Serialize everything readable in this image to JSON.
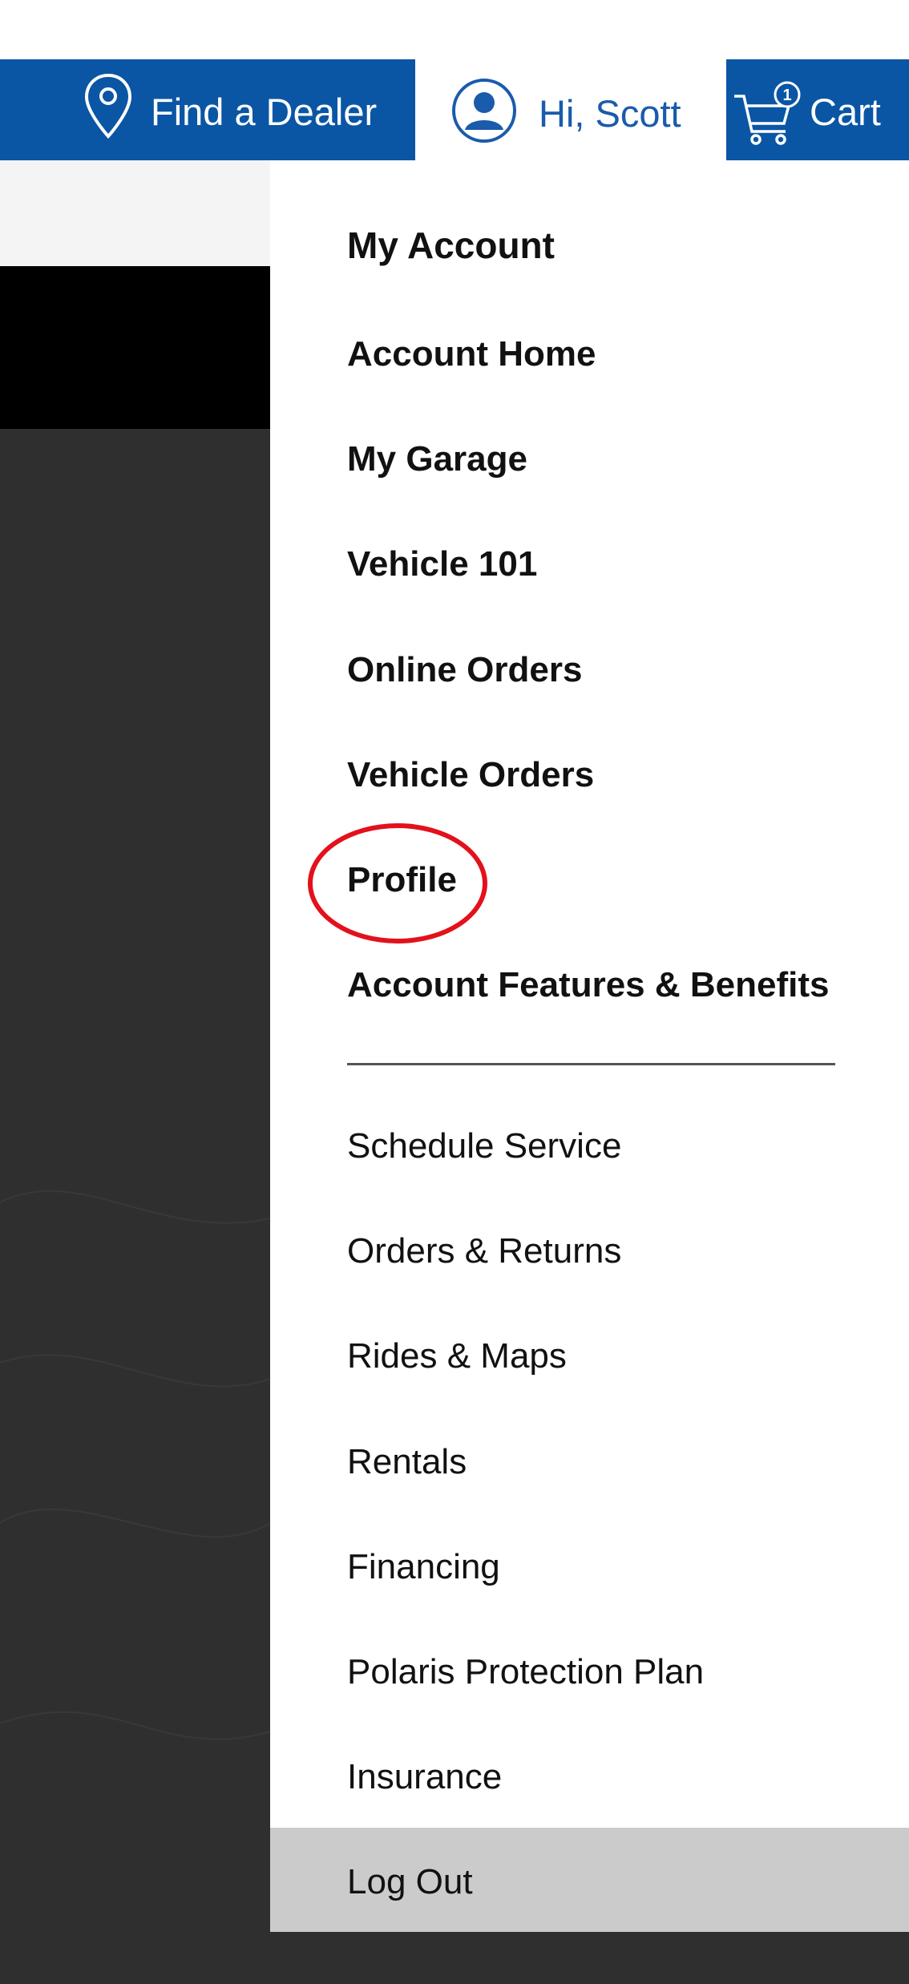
{
  "header": {
    "find_dealer_label": "Find a Dealer",
    "greeting_label": "Hi, Scott",
    "cart_label": "Cart",
    "cart_count": "1",
    "brand_color": "#0a56a5",
    "greeting_color": "#1a5bab"
  },
  "icons": {
    "dealer": "map-pin-icon",
    "account": "user-circle-icon",
    "cart": "shopping-cart-icon"
  },
  "menu": {
    "title": "My Account",
    "primary_items": [
      {
        "label": "Account Home"
      },
      {
        "label": "My Garage"
      },
      {
        "label": "Vehicle 101"
      },
      {
        "label": "Online Orders"
      },
      {
        "label": "Vehicle Orders"
      },
      {
        "label": "Profile"
      },
      {
        "label": "Account Features & Benefits"
      }
    ],
    "secondary_items": [
      {
        "label": "Schedule Service"
      },
      {
        "label": "Orders & Returns"
      },
      {
        "label": "Rides & Maps"
      },
      {
        "label": "Rentals"
      },
      {
        "label": "Financing"
      },
      {
        "label": "Polaris Protection Plan"
      },
      {
        "label": "Insurance"
      }
    ],
    "logout_label": "Log Out",
    "highlight_color": "#e3111b"
  }
}
